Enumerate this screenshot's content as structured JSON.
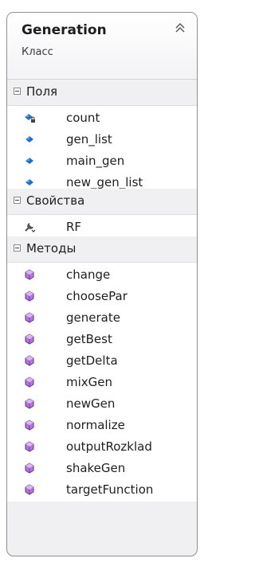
{
  "class": {
    "name": "Generation",
    "kind": "Класс"
  },
  "sections": {
    "fields": {
      "label": "Поля",
      "items": [
        {
          "label": "count",
          "icon": "private-field-icon"
        },
        {
          "label": "gen_list",
          "icon": "field-icon"
        },
        {
          "label": "main_gen",
          "icon": "field-icon"
        },
        {
          "label": "new_gen_list",
          "icon": "field-icon"
        }
      ]
    },
    "properties": {
      "label": "Свойства",
      "items": [
        {
          "label": "RF",
          "icon": "property-icon"
        }
      ]
    },
    "methods": {
      "label": "Методы",
      "items": [
        {
          "label": "change",
          "icon": "method-icon"
        },
        {
          "label": "choosePar",
          "icon": "method-icon"
        },
        {
          "label": "generate",
          "icon": "method-icon"
        },
        {
          "label": "getBest",
          "icon": "method-icon"
        },
        {
          "label": "getDelta",
          "icon": "method-icon"
        },
        {
          "label": "mixGen",
          "icon": "method-icon"
        },
        {
          "label": "newGen",
          "icon": "method-icon"
        },
        {
          "label": "normalize",
          "icon": "method-icon"
        },
        {
          "label": "outputRozklad",
          "icon": "method-icon"
        },
        {
          "label": "shakeGen",
          "icon": "method-icon"
        },
        {
          "label": "targetFunction",
          "icon": "method-icon"
        }
      ]
    }
  },
  "colors": {
    "field": "#1f6fc9",
    "method": "#7a3fa8",
    "property": "#555555",
    "border": "#8f8f8f"
  }
}
